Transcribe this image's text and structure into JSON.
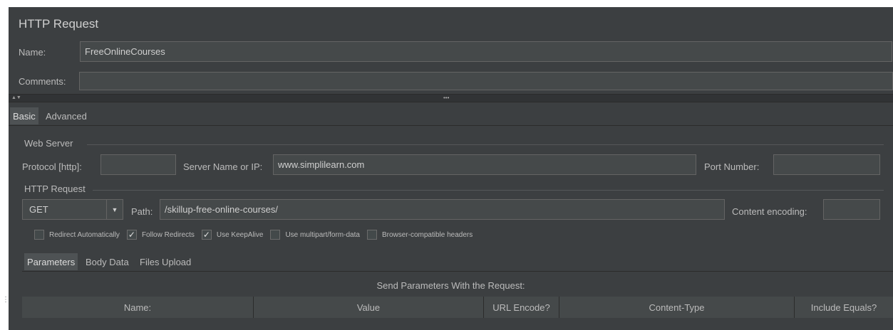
{
  "panel": {
    "title": "HTTP Request"
  },
  "name_field": {
    "label": "Name:",
    "value": "FreeOnlineCourses"
  },
  "comments_field": {
    "label": "Comments:",
    "value": ""
  },
  "splitter": {
    "arrows": "▲▼",
    "dots": "•••"
  },
  "main_tabs": [
    {
      "label": "Basic",
      "active": true
    },
    {
      "label": "Advanced",
      "active": false
    }
  ],
  "web_server": {
    "group_title": "Web Server",
    "protocol_label": "Protocol [http]:",
    "protocol_value": "",
    "server_label": "Server Name or IP:",
    "server_value": "www.simplilearn.com",
    "port_label": "Port Number:",
    "port_value": ""
  },
  "http_request": {
    "group_title": "HTTP Request",
    "method": "GET",
    "path_label": "Path:",
    "path_value": "/skillup-free-online-courses/",
    "encoding_label": "Content encoding:",
    "encoding_value": ""
  },
  "options": [
    {
      "label": "Redirect Automatically",
      "checked": false
    },
    {
      "label": "Follow Redirects",
      "checked": true
    },
    {
      "label": "Use KeepAlive",
      "checked": true
    },
    {
      "label": "Use multipart/form-data",
      "checked": false
    },
    {
      "label": "Browser-compatible headers",
      "checked": false
    }
  ],
  "sub_tabs": [
    {
      "label": "Parameters",
      "active": true
    },
    {
      "label": "Body Data",
      "active": false
    },
    {
      "label": "Files Upload",
      "active": false
    }
  ],
  "params_table": {
    "caption": "Send Parameters With the Request:",
    "columns": [
      "Name:",
      "Value",
      "URL Encode?",
      "Content-Type",
      "Include Equals?"
    ]
  },
  "colors": {
    "panel_bg": "#3c3f41",
    "field_bg": "#45494a",
    "text": "#bbbbbb"
  }
}
